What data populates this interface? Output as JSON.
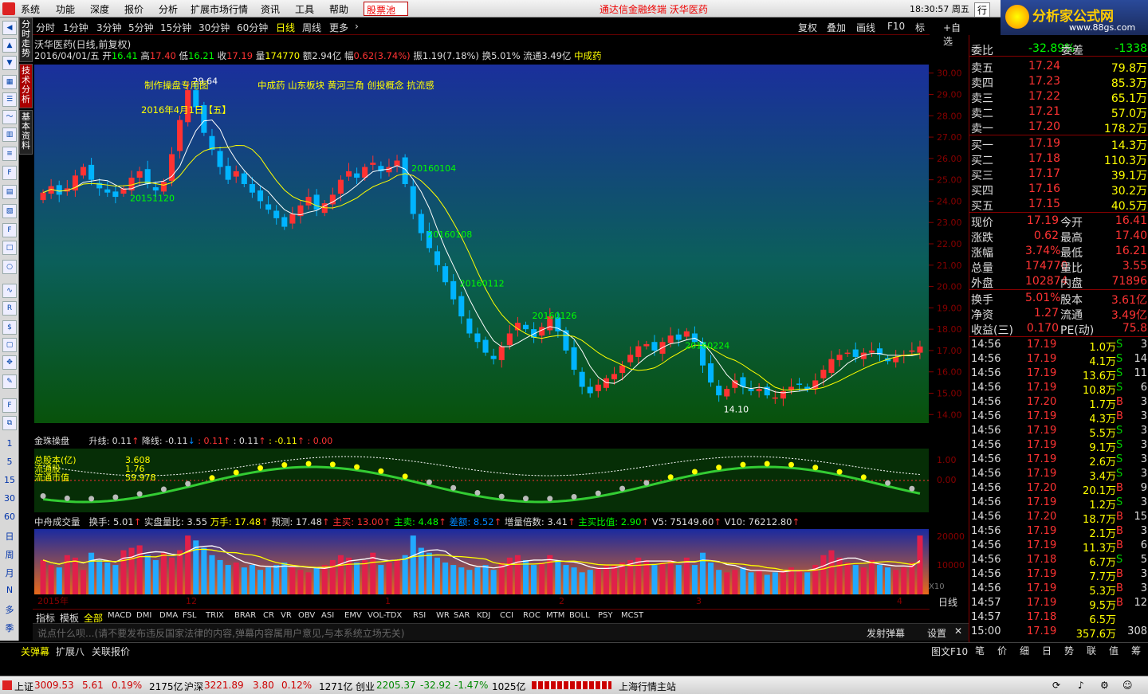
{
  "menu": {
    "items": [
      "系统",
      "功能",
      "深度",
      "报价",
      "分析",
      "扩展市场行情",
      "资讯",
      "工具",
      "帮助"
    ],
    "stock_pool": "股票池",
    "title": "通达信金融终端  沃华医药",
    "clock": "18:30:57 周五",
    "trade_btn": "行"
  },
  "ad": {
    "brand": "分析家公式网",
    "url": "www.88gs.com"
  },
  "side_tabs": [
    "分时走势",
    "技术分析",
    "基本资料"
  ],
  "left_nums": [
    "1",
    "5",
    "15",
    "30",
    "60",
    "日",
    "周",
    "月",
    "N",
    "多",
    "季",
    "年"
  ],
  "periods": [
    "分时",
    "1分钟",
    "3分钟",
    "5分钟",
    "15分钟",
    "30分钟",
    "60分钟",
    "日线",
    "周线",
    "更多"
  ],
  "right_btns": [
    "复权",
    "叠加",
    "画线",
    "F10",
    "标记",
    "+自选"
  ],
  "info": {
    "name": "沃华医药(日线,前复权)",
    "line2": {
      "date": "2016/04/01/五",
      "open_l": "开",
      "open": "16.41",
      "high_l": "高",
      "high": "17.40",
      "low_l": "低",
      "low": "16.21",
      "close_l": "收",
      "close": "17.19",
      "vol_l": "量",
      "vol": "174770",
      "amt_l": "额",
      "amt": "2.94亿",
      "chg_l": "幅",
      "chg": "0.62(3.74%)",
      "amp_l": "振",
      "amp": "1.19(7.18%)",
      "turn_l": "换",
      "turn": "5.01%",
      "float_l": "流通",
      "float": "3.49亿",
      "concept": "中成药"
    }
  },
  "chart_data": {
    "type": "candlestick",
    "ylim": [
      13.6,
      30.4
    ],
    "y_ticks": [
      "30.00",
      "29.00",
      "28.00",
      "27.00",
      "26.00",
      "25.00",
      "24.00",
      "23.00",
      "22.00",
      "21.00",
      "20.00",
      "19.00",
      "18.00",
      "17.00",
      "16.00",
      "15.00",
      "14.00"
    ],
    "annotations": [
      "29.64",
      "14.10",
      "20151120",
      "20160104",
      "20160108",
      "20160112",
      "20160126",
      "20160224"
    ],
    "header_texts": [
      "制作操盘专用图",
      "中成药 山东板块 黄河三角 创投概念 抗流感",
      "2016年4月1日【五】"
    ],
    "x_labels": [
      "2015年",
      "12",
      "1",
      "2",
      "3",
      "4"
    ],
    "closes": [
      24.4,
      24.7,
      24.3,
      24.6,
      25.2,
      25.6,
      25.0,
      24.6,
      24.4,
      24.2,
      24.6,
      25.1,
      25.4,
      24.8,
      24.5,
      24.9,
      26.2,
      27.8,
      29.2,
      28.4,
      27.2,
      26.4,
      25.6,
      25.0,
      25.4,
      24.8,
      24.4,
      24.0,
      23.6,
      23.2,
      22.8,
      23.4,
      23.8,
      24.2,
      23.6,
      23.9,
      24.3,
      25.0,
      25.4,
      25.1,
      25.6,
      25.8,
      25.4,
      25.6,
      25.9,
      24.8,
      23.4,
      22.5,
      21.8,
      21.0,
      20.2,
      19.4,
      18.6,
      17.8,
      17.4,
      16.9,
      16.6,
      17.2,
      17.8,
      18.3,
      18.0,
      17.6,
      18.1,
      18.6,
      17.9,
      17.0,
      16.1,
      15.3,
      15.0,
      15.4,
      15.7,
      15.9,
      16.3,
      16.8,
      17.2,
      17.3,
      17.0,
      17.4,
      17.7,
      17.5,
      17.9,
      17.4,
      16.3,
      15.5,
      14.9,
      15.2,
      15.6,
      15.3,
      15.1,
      15.2,
      14.9,
      14.8,
      15.1,
      15.3,
      15.4,
      15.2,
      15.6,
      16.1,
      16.6,
      16.8,
      16.9,
      16.7,
      16.9,
      17.0,
      16.8,
      16.5,
      16.7,
      16.8,
      17.0,
      17.19
    ]
  },
  "ind1": {
    "name": "金珠操盘",
    "up": "升线: 0.11",
    "down": "降线: -0.11",
    "v1": ": 0.11",
    "v2": ": 0.11",
    "v3": ": -0.11",
    "v4": ": 0.00",
    "labels": [
      "总股本(亿)",
      "流通股",
      "流通市值"
    ],
    "vals": [
      "3.608",
      "1.76",
      "59.978"
    ],
    "y_ticks": [
      "1.00",
      "0.00"
    ]
  },
  "ind2": {
    "name": "中舟成交量",
    "items": [
      "换手: 5.01",
      "实盘量比: 3.55",
      "万手: 17.48",
      "预测: 17.48",
      "主买: 13.00",
      "主卖: 4.48",
      "差额: 8.52",
      "增量倍数: 3.41",
      "主买比值: 2.90",
      "V5: 75149.60",
      "V10: 76212.80"
    ],
    "y_ticks": [
      "20000",
      "10000"
    ],
    "unit": "X10",
    "vols": [
      70,
      60,
      55,
      80,
      75,
      50,
      85,
      70,
      65,
      60,
      90,
      95,
      100,
      80,
      70,
      85,
      75,
      90,
      120,
      110,
      95,
      80,
      70,
      60,
      65,
      55,
      60,
      50,
      55,
      60,
      65,
      55,
      50,
      45,
      55,
      60,
      70,
      80,
      75,
      65,
      70,
      85,
      60,
      65,
      70,
      80,
      120,
      95,
      85,
      75,
      65,
      60,
      55,
      50,
      55,
      60,
      50,
      65,
      75,
      80,
      70,
      60,
      65,
      80,
      70,
      60,
      55,
      45,
      50,
      55,
      60,
      60,
      65,
      70,
      75,
      70,
      60,
      65,
      70,
      60,
      75,
      60,
      85,
      65,
      50,
      45,
      50,
      55,
      45,
      50,
      40,
      45,
      50,
      55,
      50,
      45,
      60,
      80,
      90,
      75,
      65,
      60,
      55,
      70,
      60,
      55,
      50,
      55,
      65,
      120
    ]
  },
  "bottom_tabs": [
    "指标",
    "模板",
    "全部",
    "MACD",
    "DMI",
    "DMA",
    "FSL",
    "TRIX",
    "BRAR",
    "CR",
    "VR",
    "OBV",
    "ASI",
    "EMV",
    "VOL-TDX",
    "RSI",
    "WR",
    "SAR",
    "KDJ",
    "CCI",
    "ROC",
    "MTM",
    "BOLL",
    "PSY",
    "MCST"
  ],
  "danmu": {
    "placeholder": "说点什么呗...(请不要发布违反国家法律的内容,弹幕内容属用户意见,与本系统立场无关)",
    "send": "发射弹幕",
    "settings": "设置"
  },
  "status": {
    "items": [
      "关弹幕",
      "扩展八",
      "关联报价"
    ],
    "f10": "图文F10"
  },
  "quote": {
    "wb": {
      "l": "委比",
      "v": "-32.89%",
      "l2": "委差",
      "v2": "-1338"
    },
    "asks": [
      {
        "l": "卖五",
        "p": "17.24",
        "v": "79.8万"
      },
      {
        "l": "卖四",
        "p": "17.23",
        "v": "85.3万"
      },
      {
        "l": "卖三",
        "p": "17.22",
        "v": "65.1万"
      },
      {
        "l": "卖二",
        "p": "17.21",
        "v": "57.0万"
      },
      {
        "l": "卖一",
        "p": "17.20",
        "v": "178.2万"
      }
    ],
    "bids": [
      {
        "l": "买一",
        "p": "17.19",
        "v": "14.3万"
      },
      {
        "l": "买二",
        "p": "17.18",
        "v": "110.3万"
      },
      {
        "l": "买三",
        "p": "17.17",
        "v": "39.1万"
      },
      {
        "l": "买四",
        "p": "17.16",
        "v": "30.2万"
      },
      {
        "l": "买五",
        "p": "17.15",
        "v": "40.5万"
      }
    ],
    "stats1": [
      {
        "l": "现价",
        "v": "17.19",
        "l2": "今开",
        "v2": "16.41"
      },
      {
        "l": "涨跌",
        "v": "0.62",
        "l2": "最高",
        "v2": "17.40"
      },
      {
        "l": "涨幅",
        "v": "3.74%",
        "l2": "最低",
        "v2": "16.21"
      },
      {
        "l": "总量",
        "v": "174770",
        "l2": "量比",
        "v2": "3.55"
      },
      {
        "l": "外盘",
        "v": "102874",
        "l2": "内盘",
        "v2": "71896"
      }
    ],
    "stats2": [
      {
        "l": "换手",
        "v": "5.01%",
        "l2": "股本",
        "v2": "3.61亿"
      },
      {
        "l": "净资",
        "v": "1.27",
        "l2": "流通",
        "v2": "3.49亿"
      },
      {
        "l": "收益(三)",
        "v": "0.170",
        "l2": "PE(动)",
        "v2": "75.8"
      }
    ],
    "ticks": [
      [
        "14:56",
        "17.19",
        "1.0万",
        "S",
        "3"
      ],
      [
        "14:56",
        "17.19",
        "4.1万",
        "S",
        "14"
      ],
      [
        "14:56",
        "17.19",
        "13.6万",
        "S",
        "11"
      ],
      [
        "14:56",
        "17.19",
        "10.8万",
        "S",
        "6"
      ],
      [
        "14:56",
        "17.20",
        "1.7万",
        "B",
        "3"
      ],
      [
        "14:56",
        "17.19",
        "4.3万",
        "B",
        "3"
      ],
      [
        "14:56",
        "17.19",
        "5.5万",
        "S",
        "3"
      ],
      [
        "14:56",
        "17.19",
        "9.1万",
        "S",
        "3"
      ],
      [
        "14:56",
        "17.19",
        "2.6万",
        "S",
        "3"
      ],
      [
        "14:56",
        "17.19",
        "3.4万",
        "S",
        "3"
      ],
      [
        "14:56",
        "17.20",
        "20.1万",
        "B",
        "9"
      ],
      [
        "14:56",
        "17.19",
        "1.2万",
        "S",
        "3"
      ],
      [
        "14:56",
        "17.20",
        "18.7万",
        "B",
        "15"
      ],
      [
        "14:56",
        "17.19",
        "2.1万",
        "B",
        "3"
      ],
      [
        "14:56",
        "17.19",
        "11.3万",
        "B",
        "6"
      ],
      [
        "14:56",
        "17.18",
        "6.7万",
        "S",
        "5"
      ],
      [
        "14:56",
        "17.19",
        "7.7万",
        "B",
        "3"
      ],
      [
        "14:56",
        "17.19",
        "5.3万",
        "B",
        "3"
      ],
      [
        "14:57",
        "17.19",
        "9.5万",
        "B",
        "12"
      ],
      [
        "14:57",
        "17.18",
        "6.5万",
        "",
        ""
      ],
      [
        "15:00",
        "17.19",
        "357.6万",
        "",
        "308"
      ]
    ],
    "tabs": [
      "笔",
      "价",
      "细",
      "日",
      "势",
      "联",
      "值",
      "筹"
    ],
    "rlabel": "日线"
  },
  "footer": {
    "sh": "上证",
    "sh_v": "3009.53",
    "sh_c": "5.61",
    "sh_p": "0.19%",
    "sh_a": "2175亿",
    "sz": "沪深",
    "sz_v": "3221.89",
    "sz_c": "3.80",
    "sz_p": "0.12%",
    "sz_a": "1271亿",
    "cy": "创业",
    "cy_v": "2205.37",
    "cy_c": "-32.92",
    "cy_p": "-1.47%",
    "cy_a": "1025亿",
    "site": "上海行情主站"
  },
  "colors": {
    "up": "#ff3232",
    "down": "#00b4ff",
    "accent": "#ffff00"
  }
}
